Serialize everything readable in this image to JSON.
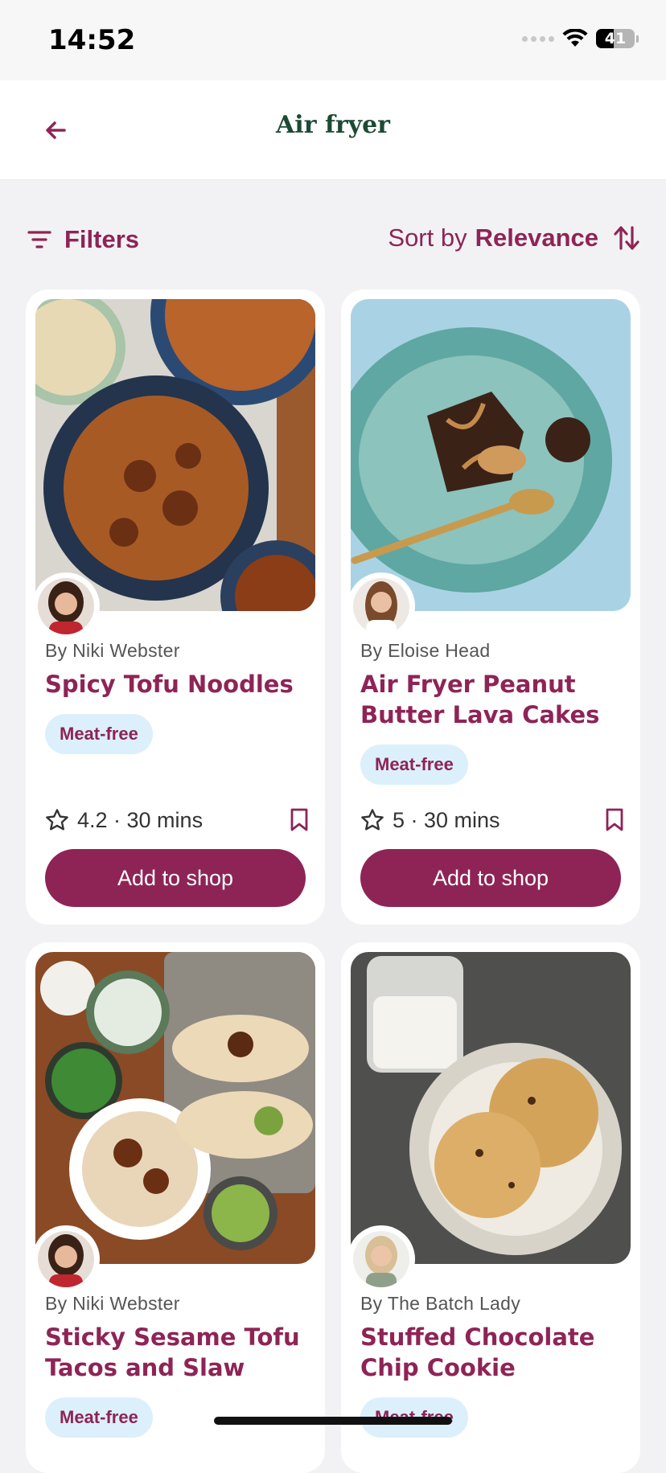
{
  "status_bar": {
    "time": "14:52",
    "battery": "41"
  },
  "header": {
    "title": "Air fryer",
    "back_icon": "arrow-left-icon"
  },
  "toolbar": {
    "filters_label": "Filters",
    "sort_prefix": "Sort by",
    "sort_value": "Relevance"
  },
  "colors": {
    "brand": "#8e2456",
    "title_green": "#1c4a33",
    "tag_bg": "#dcf0fb"
  },
  "recipes": [
    {
      "author": "By Niki Webster",
      "title": "Spicy Tofu Noodles",
      "tag": "Meat-free",
      "meta": "4.2 · 30 mins",
      "button": "Add to shop"
    },
    {
      "author": "By Eloise Head",
      "title": "Air Fryer Peanut Butter Lava Cakes",
      "tag": "Meat-free",
      "meta": "5 · 30 mins",
      "button": "Add to shop"
    },
    {
      "author": "By Niki Webster",
      "title": "Sticky Sesame Tofu Tacos and Slaw",
      "tag": "Meat-free"
    },
    {
      "author": "By The Batch Lady",
      "title": "Stuffed Chocolate Chip Cookie",
      "tag": "Meat-free"
    }
  ]
}
